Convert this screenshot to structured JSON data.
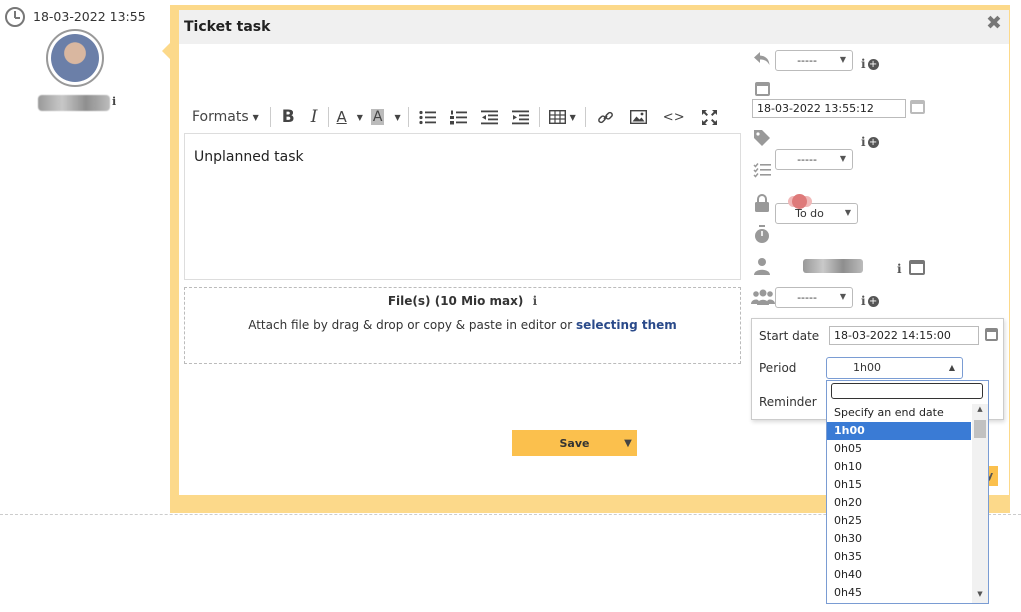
{
  "comment": {
    "timestamp": "18-03-2022 13:55"
  },
  "modal": {
    "title": "Ticket task",
    "close_glyph": "✖"
  },
  "toolbar": {
    "formats_label": "Formats"
  },
  "editor": {
    "content": "Unplanned task"
  },
  "files": {
    "title": "File(s) (10 Mio max)",
    "attach_text": "Attach file by drag & drop or copy & paste in editor or ",
    "attach_link": "selecting them"
  },
  "actions": {
    "save_label": "Save",
    "bottom_partial": "y"
  },
  "fields": {
    "reply_value": "-----",
    "date_value": "18-03-2022 13:55:12",
    "tag_value": "-----",
    "status_value": "To do",
    "timer_value": "-----",
    "group_value": "-----"
  },
  "reminder_popup": {
    "start_date_label": "Start date",
    "start_date_value": "18-03-2022 14:15:00",
    "period_label": "Period",
    "period_value": "1h00",
    "reminder_label": "Reminder"
  },
  "period_options": [
    "Specify an end date",
    "1h00",
    "0h05",
    "0h10",
    "0h15",
    "0h20",
    "0h25",
    "0h30",
    "0h35",
    "0h40",
    "0h45"
  ],
  "colors": {
    "frame": "#fcd98a",
    "button": "#fbc04d",
    "selected_option": "#3a7bd5",
    "link": "#2a4a8a"
  }
}
